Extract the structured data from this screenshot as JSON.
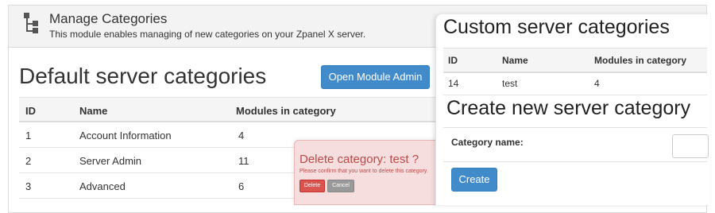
{
  "module": {
    "title": "Manage Categories",
    "description": "This module enables managing of new categories on your Zpanel X server.",
    "icon": "category-tree-icon"
  },
  "default_section": {
    "heading": "Default server categories",
    "open_admin_label": "Open Module Admin",
    "columns": [
      "ID",
      "Name",
      "Modules in category"
    ],
    "rows": [
      {
        "id": "1",
        "name": "Account Information",
        "modules": "4"
      },
      {
        "id": "2",
        "name": "Server Admin",
        "modules": "11"
      },
      {
        "id": "3",
        "name": "Advanced",
        "modules": "6"
      }
    ]
  },
  "custom_section": {
    "heading": "Custom server categories",
    "columns": [
      "ID",
      "Name",
      "Modules in category"
    ],
    "rows": [
      {
        "id": "14",
        "name": "test",
        "modules": "4"
      }
    ]
  },
  "create_section": {
    "heading": "Create new server category",
    "label": "Category name:",
    "input_value": "",
    "button_label": "Create"
  },
  "delete_popup": {
    "title": "Delete category: test ?",
    "message": "Please confirm that you want to delete this category.",
    "delete_label": "Delete",
    "cancel_label": "Cancel"
  },
  "colors": {
    "primary": "#428bca",
    "danger": "#d9534f",
    "danger_text": "#b94a48",
    "danger_bg": "#f7dede",
    "cancel": "#999999"
  }
}
